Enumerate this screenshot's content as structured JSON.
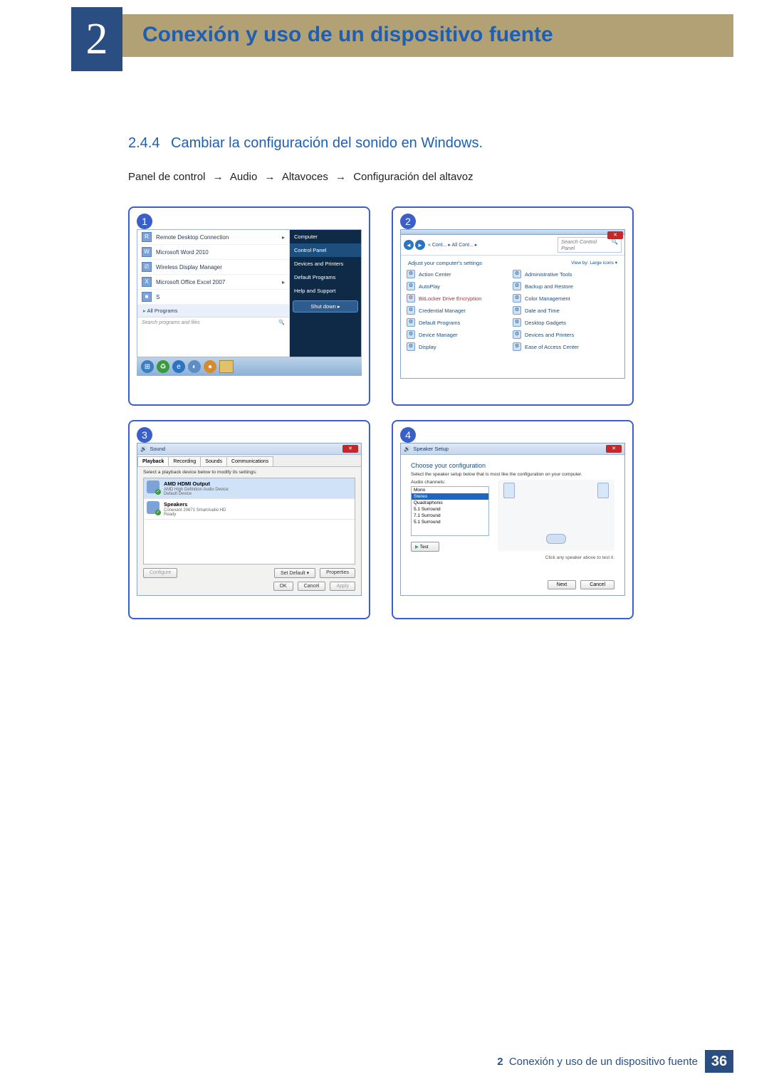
{
  "chapter_number": "2",
  "page_title": "Conexión y uso de un dispositivo fuente",
  "section": {
    "number": "2.4.4",
    "title": "Cambiar la configuración del sonido en Windows."
  },
  "breadcrumb": {
    "p1": "Panel de control",
    "p2": "Audio",
    "p3": "Altavoces",
    "p4": "Configuración del altavoz",
    "arrow": "→"
  },
  "panel1": {
    "badge": "1",
    "left_items": [
      {
        "icon": "R",
        "label": "Remote Desktop Connection",
        "sub": true
      },
      {
        "icon": "W",
        "label": "Microsoft Word 2010"
      },
      {
        "icon": "⎚",
        "label": "Wireless Display Manager"
      },
      {
        "icon": "X",
        "label": "Microsoft Office Excel 2007",
        "sub": true
      },
      {
        "icon": "■",
        "label": "S"
      }
    ],
    "all_programs": "All Programs",
    "search_placeholder": "Search programs and files",
    "right_items": [
      "Computer",
      "Control Panel",
      "Devices and Printers",
      "Default Programs",
      "Help and Support"
    ],
    "shutdown": "Shut down"
  },
  "panel2": {
    "badge": "2",
    "crumb": [
      "« Cont...",
      "All Cont..."
    ],
    "search_placeholder": "Search Control Panel",
    "adjust": "Adjust your computer's settings",
    "view": "View by:   Large icons ▾",
    "col1": [
      {
        "t": "Action Center",
        "hl": false
      },
      {
        "t": "AutoPlay",
        "hl": false
      },
      {
        "t": "BitLocker Drive Encryption",
        "hl": true
      },
      {
        "t": "Credential Manager",
        "hl": false
      },
      {
        "t": "Default Programs",
        "hl": false
      },
      {
        "t": "Device Manager",
        "hl": false
      },
      {
        "t": "Display",
        "hl": false
      }
    ],
    "col2": [
      {
        "t": "Administrative Tools",
        "hl": false
      },
      {
        "t": "Backup and Restore",
        "hl": false
      },
      {
        "t": "Color Management",
        "hl": false
      },
      {
        "t": "Date and Time",
        "hl": false
      },
      {
        "t": "Desktop Gadgets",
        "hl": false
      },
      {
        "t": "Devices and Printers",
        "hl": false
      },
      {
        "t": "Ease of Access Center",
        "hl": false
      }
    ]
  },
  "panel3": {
    "badge": "3",
    "title": "Sound",
    "tabs": [
      "Playback",
      "Recording",
      "Sounds",
      "Communications"
    ],
    "instruction": "Select a playback device below to modify its settings:",
    "devices": [
      {
        "name": "AMD HDMI Output",
        "line2": "AMD High Definition Audio Device",
        "line3": "Default Device",
        "sel": true
      },
      {
        "name": "Speakers",
        "line2": "Conexant 20671 SmartAudio HD",
        "line3": "Ready",
        "sel": false
      }
    ],
    "btn_configure": "Configure",
    "btn_setdefault": "Set Default",
    "btn_properties": "Properties",
    "btn_ok": "OK",
    "btn_cancel": "Cancel",
    "btn_apply": "Apply"
  },
  "panel4": {
    "badge": "4",
    "title": "Speaker Setup",
    "heading": "Choose your configuration",
    "instruction": "Select the speaker setup below that is most like the configuration on your computer.",
    "label_channels": "Audio channels:",
    "options": [
      "Mono",
      "Stereo",
      "Quadraphonic",
      "5.1 Surround",
      "7.1 Surround",
      "5.1 Surround"
    ],
    "selected_index": 1,
    "btn_test": "Test",
    "hint": "Click any speaker above to test it.",
    "btn_next": "Next",
    "btn_cancel": "Cancel"
  },
  "footer": {
    "chapter": "2",
    "text": "Conexión y uso de un dispositivo fuente",
    "page": "36"
  }
}
